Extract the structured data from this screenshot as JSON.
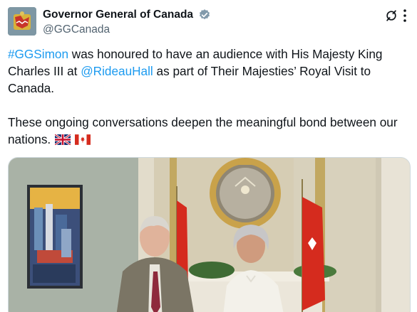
{
  "account": {
    "display_name": "Governor General of Canada",
    "handle": "@GGCanada",
    "verified": true,
    "avatar_icon": "canada-coat-of-arms-icon"
  },
  "actions": {
    "grok_icon": "grok-icon",
    "more_icon": "more-options-icon"
  },
  "tweet": {
    "paragraph1": {
      "hashtag": "#GGSimon",
      "text1": " was honoured to have an audience with His Majesty King Charles III at ",
      "mention": "@RideauHall",
      "text2": " as part of Their Majesties’ Royal Visit to Canada."
    },
    "paragraph2": {
      "text": "These ongoing conversations deepen the meaningful bond between our nations."
    },
    "flags": [
      "uk-flag-icon",
      "canada-flag-icon"
    ]
  },
  "media": {
    "photo_icon": "photo-king-and-governor-general"
  },
  "colors": {
    "link": "#1d9bf0",
    "secondary_text": "#536471",
    "verified": "#829aab"
  }
}
